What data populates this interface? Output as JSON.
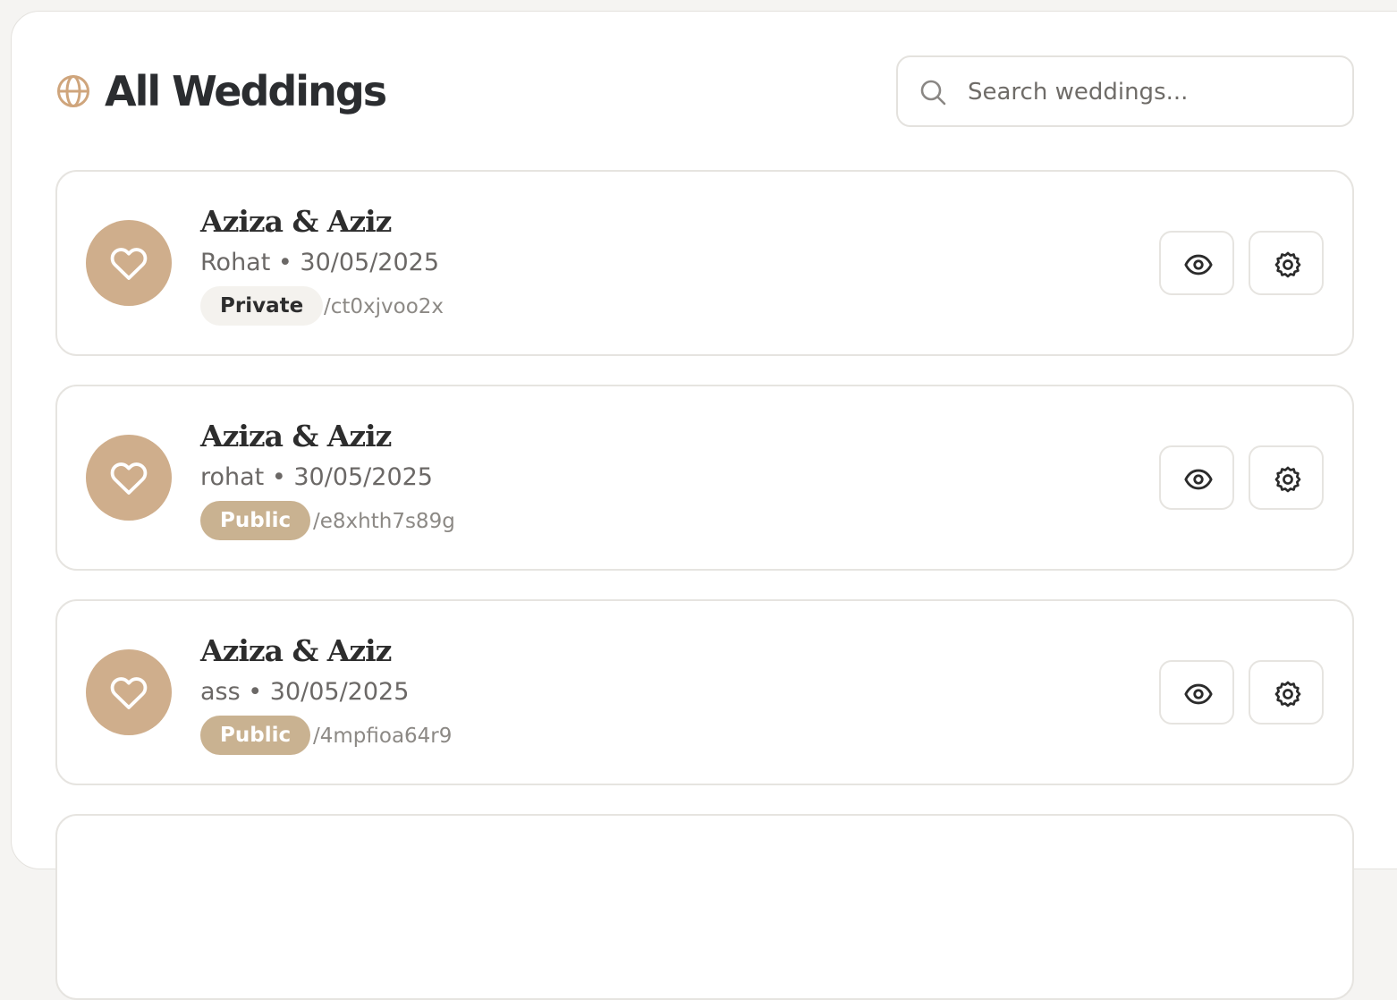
{
  "header": {
    "title": "All Weddings",
    "search_placeholder": "Search weddings..."
  },
  "colors": {
    "accent": "#cfae8c",
    "public_badge": "#c9b291",
    "private_badge": "#f4f2ee"
  },
  "weddings": [
    {
      "couple": "Aziza & Aziz",
      "meta": "Rohat • 30/05/2025",
      "visibility": "Private",
      "slug": "/ct0xjvoo2x"
    },
    {
      "couple": "Aziza & Aziz",
      "meta": "rohat • 30/05/2025",
      "visibility": "Public",
      "slug": "/e8xhth7s89g"
    },
    {
      "couple": "Aziza & Aziz",
      "meta": "ass • 30/05/2025",
      "visibility": "Public",
      "slug": "/4mpfioa64r9"
    }
  ],
  "icons": {
    "title": "globe-icon",
    "search": "search-icon",
    "avatar": "heart-icon",
    "view": "eye-icon",
    "settings": "gear-icon"
  }
}
